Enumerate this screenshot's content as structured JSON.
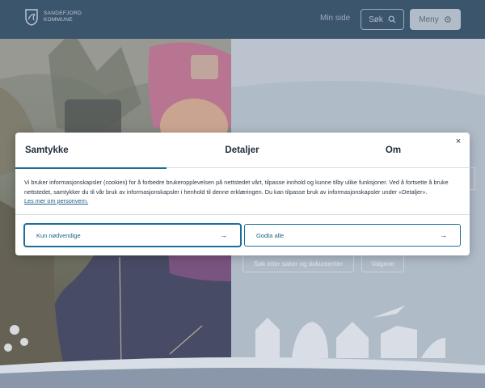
{
  "header": {
    "logo_line1": "SANDEFJORD",
    "logo_line2": "KOMMUNE",
    "my_page": "Min side",
    "search_label": "Søk",
    "menu_label": "Meny"
  },
  "background": {
    "chip_one": "Søk etter saker og dokumenter",
    "chip_two": "Valgene"
  },
  "consent": {
    "tabs": [
      "Samtykke",
      "Detaljer",
      "Om"
    ],
    "active_tab": "Samtykke",
    "close_label": "×",
    "body": "Vi bruker informasjonskapsler (cookies) for å forbedre brukeropplevelsen på nettstedet vårt, tilpasse innhold og kunne tilby ulike funksjoner. Ved å fortsette å bruke nettstedet, samtykker du til vår bruk av informasjonskapsler i henhold til denne erklæringen. Du kan tilpasse bruk av informasjonskapsler under «Detaljer».",
    "link": "Les mer om personvern.",
    "btn_necessary": "Kun nødvendige",
    "btn_accept": "Godta alle",
    "arrow": "→"
  },
  "colors": {
    "accent": "#1b6f9b",
    "header_bg": "#2d4a63"
  }
}
